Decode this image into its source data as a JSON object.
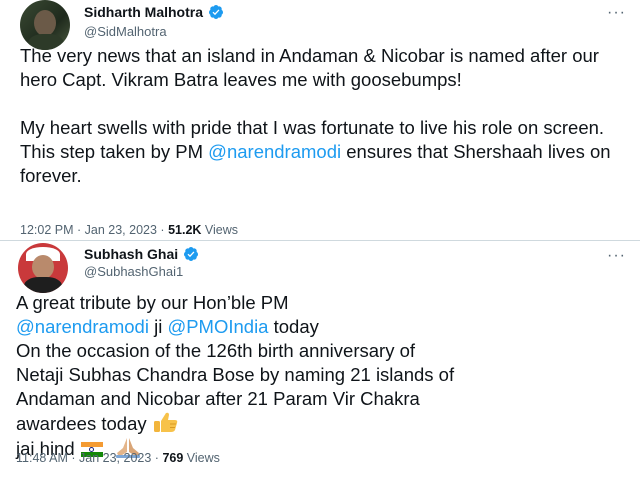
{
  "tweets": [
    {
      "display_name": "Sidharth Malhotra",
      "handle": "@SidMalhotra",
      "more": "···",
      "paragraph1": "The very news that an island in Andaman & Nicobar is named after our hero Capt. Vikram Batra leaves me with goosebumps!",
      "paragraph2_before": "My heart swells with pride that I was fortunate to live his role on screen. This step taken by PM ",
      "paragraph2_mention": "@narendramodi",
      "paragraph2_after": " ensures that Shershaah lives on forever.",
      "time": "12:02 PM",
      "date": "Jan 23, 2023",
      "views_count": "51.2K",
      "views_label": "Views"
    },
    {
      "display_name": "Subhash Ghai",
      "handle": "@SubhashGhai1",
      "more": "···",
      "line1": "A great tribute by our Hon’ble PM",
      "mention1": "@narendramodi",
      "line2_mid": " ji ",
      "mention2": "@PMOIndia",
      "line2_end": " today",
      "line3": "On the occasion of the 126th birth anniversary of",
      "line4": "Netaji Subhas Chandra Bose by naming  21 islands of",
      "line5": "Andaman and Nicobar after 21 Param Vir Chakra",
      "line6": "awardees today",
      "line7": "jai hind",
      "time": "11:48 AM",
      "date": "Jan 23, 2023",
      "views_count": "769",
      "views_label": "Views"
    }
  ],
  "colors": {
    "link": "#1d9bf0",
    "text": "#0f1419",
    "secondary": "#536471",
    "verified": "#1d9bf0"
  },
  "icons": [
    "verified-badge-icon",
    "more-options-icon",
    "thumbs-up-emoji",
    "india-flag-emoji",
    "folded-hands-emoji"
  ]
}
